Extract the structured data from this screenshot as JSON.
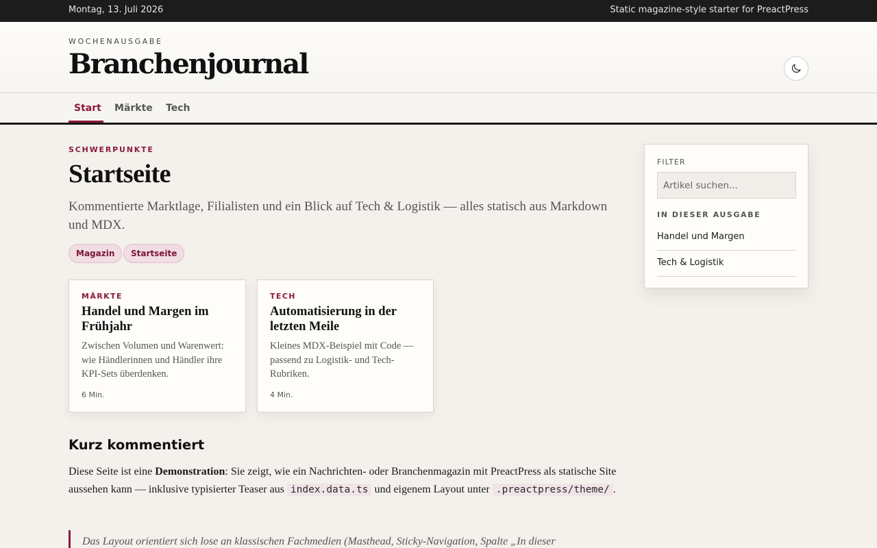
{
  "topbar": {
    "date": "Montag, 13. Juli 2026",
    "tagline": "Static magazine-style starter for PreactPress"
  },
  "masthead": {
    "kicker": "WOCHENAUSGABE",
    "title": "Branchenjournal",
    "theme_icon": "moon-icon"
  },
  "nav": {
    "items": [
      {
        "label": "Start",
        "active": true
      },
      {
        "label": "Märkte",
        "active": false
      },
      {
        "label": "Tech",
        "active": false
      }
    ]
  },
  "hero": {
    "kicker": "SCHWERPUNKTE",
    "title": "Startseite",
    "lede": "Kommentierte Marktlage, Filialisten und ein Blick auf Tech & Logistik — alles statisch aus Markdown und MDX."
  },
  "tags": [
    "Magazin",
    "Startseite"
  ],
  "cards": [
    {
      "kicker": "MÄRKTE",
      "title": "Handel und Margen im Frühjahr",
      "desc": "Zwischen Volumen und Warenwert: wie Händlerinnen und Händler ihre KPI-Sets überdenken.",
      "meta": "6 Min."
    },
    {
      "kicker": "TECH",
      "title": "Automatisierung in der letzten Meile",
      "desc": "Kleines MDX-Beispiel mit Code — passend zu Logistik- und Tech-Rubriken.",
      "meta": "4 Min."
    }
  ],
  "content": {
    "heading": "Kurz kommentiert",
    "p1_start": "Diese Seite ist eine ",
    "p1_bold": "Demonstration",
    "p1_mid": ": Sie zeigt, wie ein Nachrichten- oder Branchenmagazin mit PreactPress als statische Site aussehen kann — inklusive typisierter Teaser aus ",
    "p1_code1": "index.data.ts",
    "p1_mid2": " und eigenem Layout unter ",
    "p1_code2": ".preactpress/theme/",
    "p1_end": ".",
    "quote": "Das Layout orientiert sich lose an klassischen Fachmedien (Masthead, Sticky-Navigation, Spalte „In dieser"
  },
  "sidebar": {
    "filter_label": "FILTER",
    "search_placeholder": "Artikel suchen...",
    "issue_label": "IN DIESER AUSGABE",
    "links": [
      "Handel und Margen",
      "Tech & Logistik"
    ]
  },
  "colors": {
    "accent": "#8b1a3c",
    "topbar": "#1c1c1c",
    "background": "#f4f1ec"
  }
}
